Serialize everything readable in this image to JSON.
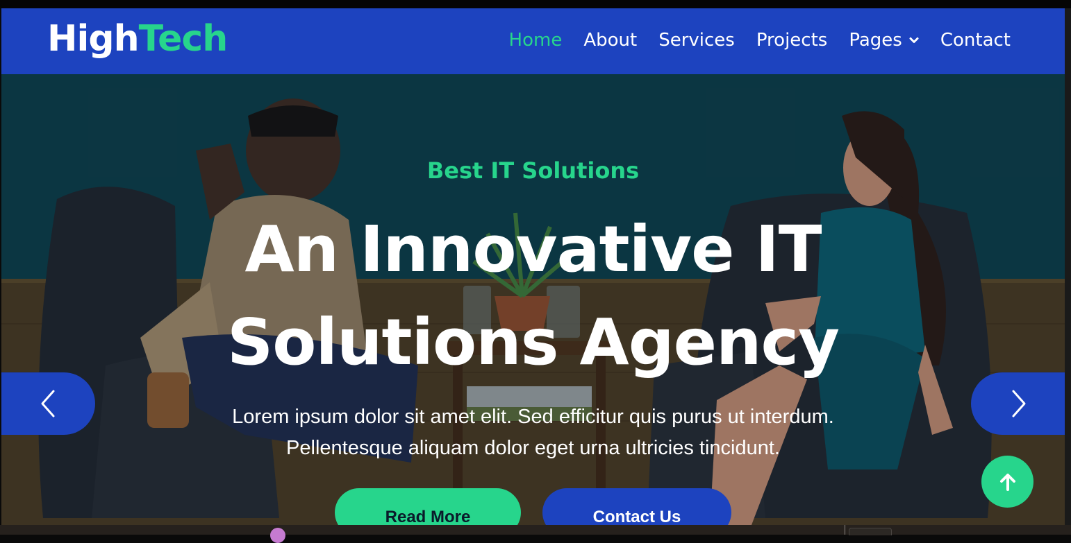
{
  "brand": {
    "part1": "High",
    "part2": "Tech"
  },
  "nav": {
    "items": [
      {
        "label": "Home",
        "active": true
      },
      {
        "label": "About"
      },
      {
        "label": "Services"
      },
      {
        "label": "Projects"
      },
      {
        "label": "Pages",
        "has_dropdown": true
      },
      {
        "label": "Contact"
      }
    ]
  },
  "hero": {
    "subtitle": "Best IT Solutions",
    "headline_line1": "An Innovative IT",
    "headline_line2": "Solutions Agency",
    "lead_line1": "Lorem ipsum dolor sit amet elit. Sed efficitur quis purus ut interdum.",
    "lead_line2": "Pellentesque aliquam dolor eget urna ultricies tincidunt.",
    "primary_button": "Read More",
    "secondary_button": "Contact Us"
  },
  "icons": {
    "prev": "chevron-left-icon",
    "next": "chevron-right-icon",
    "back_to_top": "arrow-up-icon",
    "dropdown": "chevron-down-icon"
  },
  "colors": {
    "primary": "#1d43bf",
    "accent": "#27d58c",
    "text_light": "#ffffff"
  }
}
